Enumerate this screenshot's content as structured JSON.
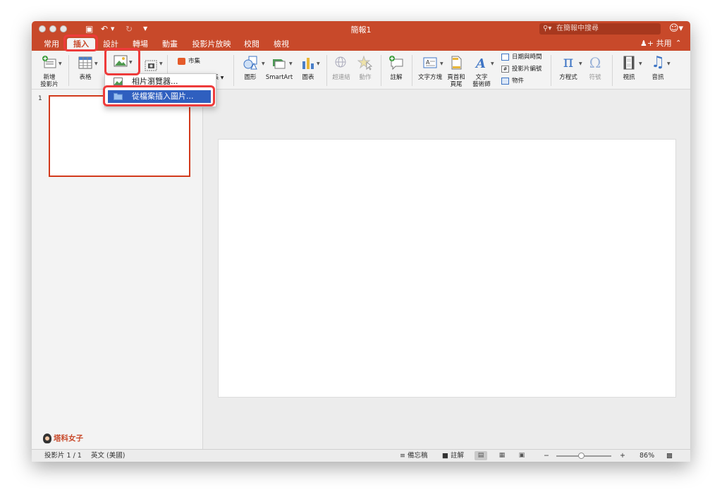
{
  "window": {
    "title": "簡報1",
    "search_placeholder": "在簡報中搜尋",
    "share_label": "共用"
  },
  "tabs": [
    {
      "label": "常用"
    },
    {
      "label": "插入",
      "active": true
    },
    {
      "label": "設計"
    },
    {
      "label": "轉場"
    },
    {
      "label": "動畫"
    },
    {
      "label": "投影片放映"
    },
    {
      "label": "校閱"
    },
    {
      "label": "檢視"
    }
  ],
  "ribbon": {
    "new_slide": "新增\n投影片",
    "table": "表格",
    "store": "市集",
    "addins": "益集",
    "shapes": "圖形",
    "smartart": "SmartArt",
    "chart": "圖表",
    "hyperlink": "超連結",
    "action": "動作",
    "comment": "註解",
    "textbox": "文字方塊",
    "header_footer": "頁首和\n頁尾",
    "wordart": "文字\n藝術師",
    "date_time": "日期與時間",
    "slide_number": "投影片編號",
    "object": "物件",
    "equation": "方程式",
    "symbol": "符號",
    "video": "視訊",
    "audio": "音訊"
  },
  "picture_menu": {
    "items": [
      {
        "label": "相片瀏覽器..."
      },
      {
        "label": "從檔案插入圖片...",
        "selected": true
      }
    ]
  },
  "slides_pane": {
    "slide_number": "1"
  },
  "watermark": "塔科女子",
  "status": {
    "slide_info": "投影片 1 / 1",
    "language": "英文 (美國)",
    "notes": "備忘稿",
    "comments": "註解",
    "zoom_minus": "−",
    "zoom_plus": "+",
    "zoom": "86%",
    "zoom_level": 0.45
  },
  "colors": {
    "accent": "#c8492a",
    "highlight": "#ee3b3b",
    "menu_selection": "#2f5fbf"
  }
}
